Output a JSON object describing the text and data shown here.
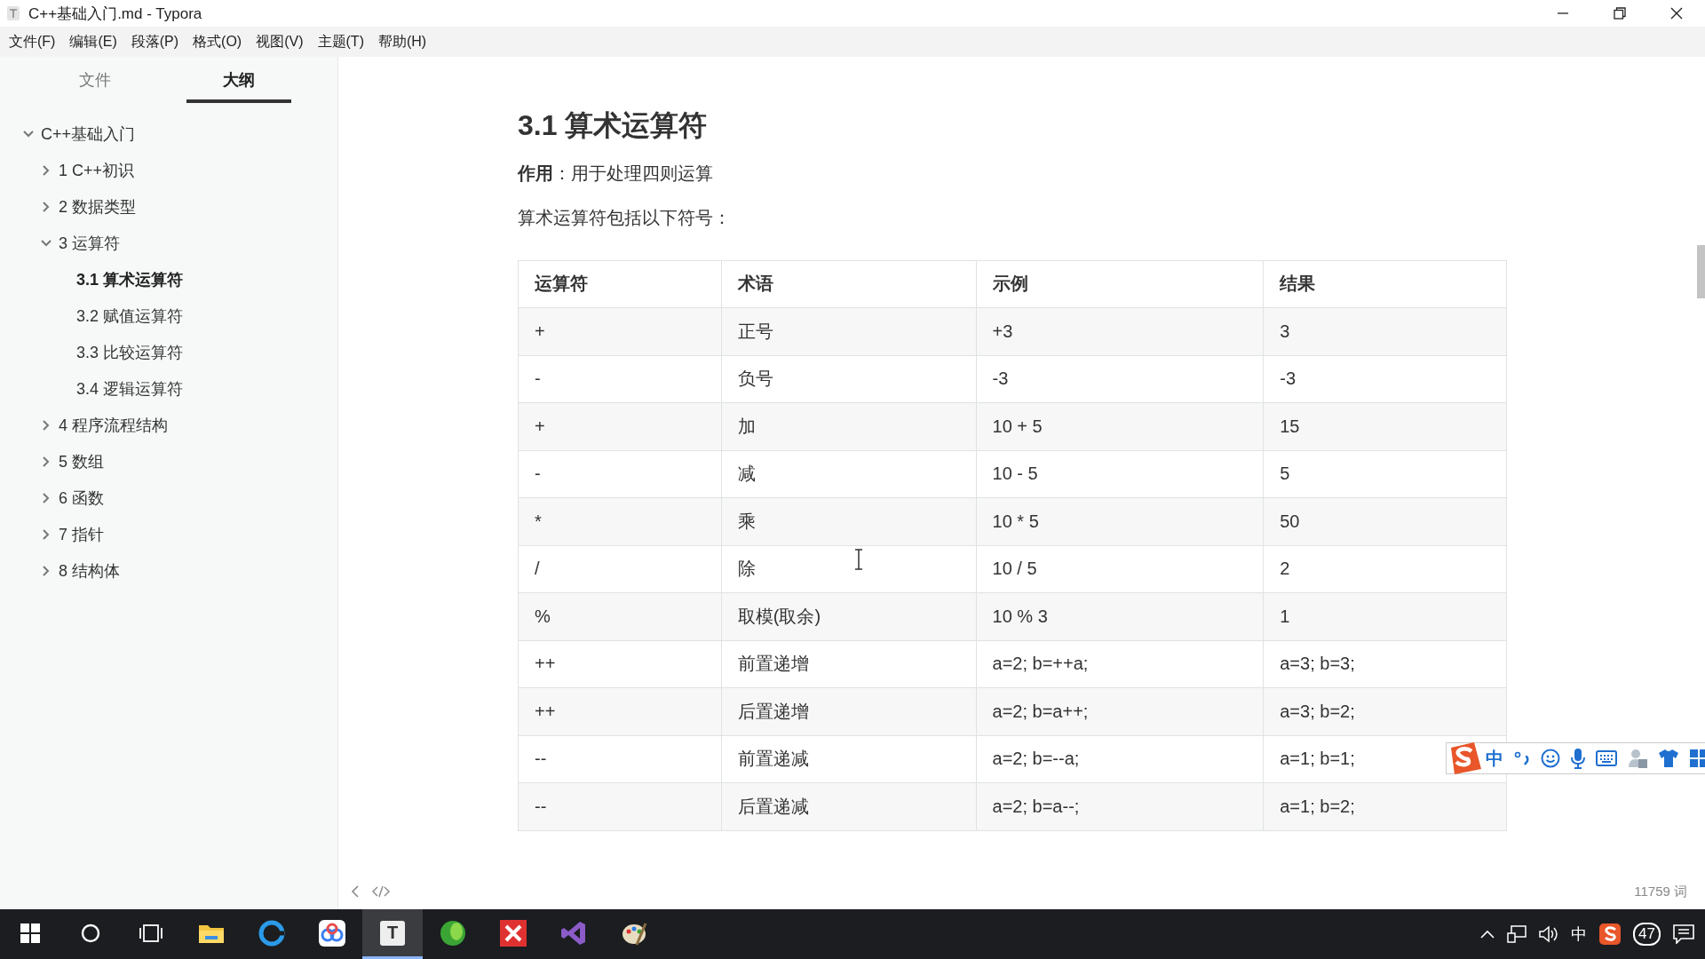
{
  "window": {
    "title": "C++基础入门.md - Typora"
  },
  "menu": [
    "文件(F)",
    "编辑(E)",
    "段落(P)",
    "格式(O)",
    "视图(V)",
    "主题(T)",
    "帮助(H)"
  ],
  "sidebar": {
    "tabs": [
      {
        "label": "文件",
        "selected": false
      },
      {
        "label": "大纲",
        "selected": true
      }
    ],
    "outline": [
      {
        "label": "C++基础入门",
        "expanded": true,
        "selected": false,
        "children": [
          {
            "label": "1 C++初识",
            "expanded": false,
            "selected": false
          },
          {
            "label": "2 数据类型",
            "expanded": false,
            "selected": false
          },
          {
            "label": "3 运算符",
            "expanded": true,
            "selected": false,
            "children": [
              {
                "label": "3.1 算术运算符",
                "selected": true
              },
              {
                "label": "3.2 赋值运算符",
                "selected": false
              },
              {
                "label": "3.3 比较运算符",
                "selected": false
              },
              {
                "label": "3.4 逻辑运算符",
                "selected": false
              }
            ]
          },
          {
            "label": "4 程序流程结构",
            "expanded": false,
            "selected": false
          },
          {
            "label": "5 数组",
            "expanded": false,
            "selected": false
          },
          {
            "label": "6 函数",
            "expanded": false,
            "selected": false
          },
          {
            "label": "7 指针",
            "expanded": false,
            "selected": false
          },
          {
            "label": "8 结构体",
            "expanded": false,
            "selected": false
          }
        ]
      }
    ]
  },
  "document": {
    "heading": "3.1 算术运算符",
    "intro": "**作用**：用于处理四则运算",
    "lead": "算术运算符包括以下符号：",
    "table": {
      "columns": [
        "运算符",
        "术语",
        "示例",
        "结果"
      ],
      "rows": [
        [
          "+",
          "正号",
          "+3",
          "3"
        ],
        [
          "-",
          "负号",
          "-3",
          "-3"
        ],
        [
          "+",
          "加",
          "10 + 5",
          "15"
        ],
        [
          "-",
          "减",
          "10 - 5",
          "5"
        ],
        [
          "*",
          "乘",
          "10 * 5",
          "50"
        ],
        [
          "/",
          "除",
          "10 / 5",
          "2"
        ],
        [
          "%",
          "取模(取余)",
          "10 % 3",
          "1"
        ],
        [
          "++",
          "前置递增",
          "a=2; b=++a;",
          "a=3; b=3;"
        ],
        [
          "++",
          "后置递增",
          "a=2; b=a++;",
          "a=3; b=2;"
        ],
        [
          "--",
          "前置递减",
          "a=2; b=--a;",
          "a=1; b=1;"
        ],
        [
          "--",
          "后置递减",
          "a=2; b=a--;",
          "a=1; b=2;"
        ]
      ]
    }
  },
  "status_bar": {
    "word_count": "11759 词"
  },
  "ime_toolbar": {
    "mode": "中"
  },
  "taskbar": {
    "apps": [
      {
        "kind": "start",
        "selected": false
      },
      {
        "kind": "search",
        "selected": false
      },
      {
        "kind": "taskview",
        "selected": false
      },
      {
        "kind": "folder",
        "selected": false
      },
      {
        "kind": "ring",
        "selected": false
      },
      {
        "kind": "cloud",
        "selected": false
      },
      {
        "kind": "letter",
        "label": "T",
        "selected": true
      },
      {
        "kind": "ball",
        "selected": false
      },
      {
        "kind": "cross",
        "selected": false
      },
      {
        "kind": "bracket",
        "selected": false
      },
      {
        "kind": "palette",
        "selected": false
      }
    ],
    "tray": {
      "ime_mode": "中",
      "badge": "47"
    }
  }
}
